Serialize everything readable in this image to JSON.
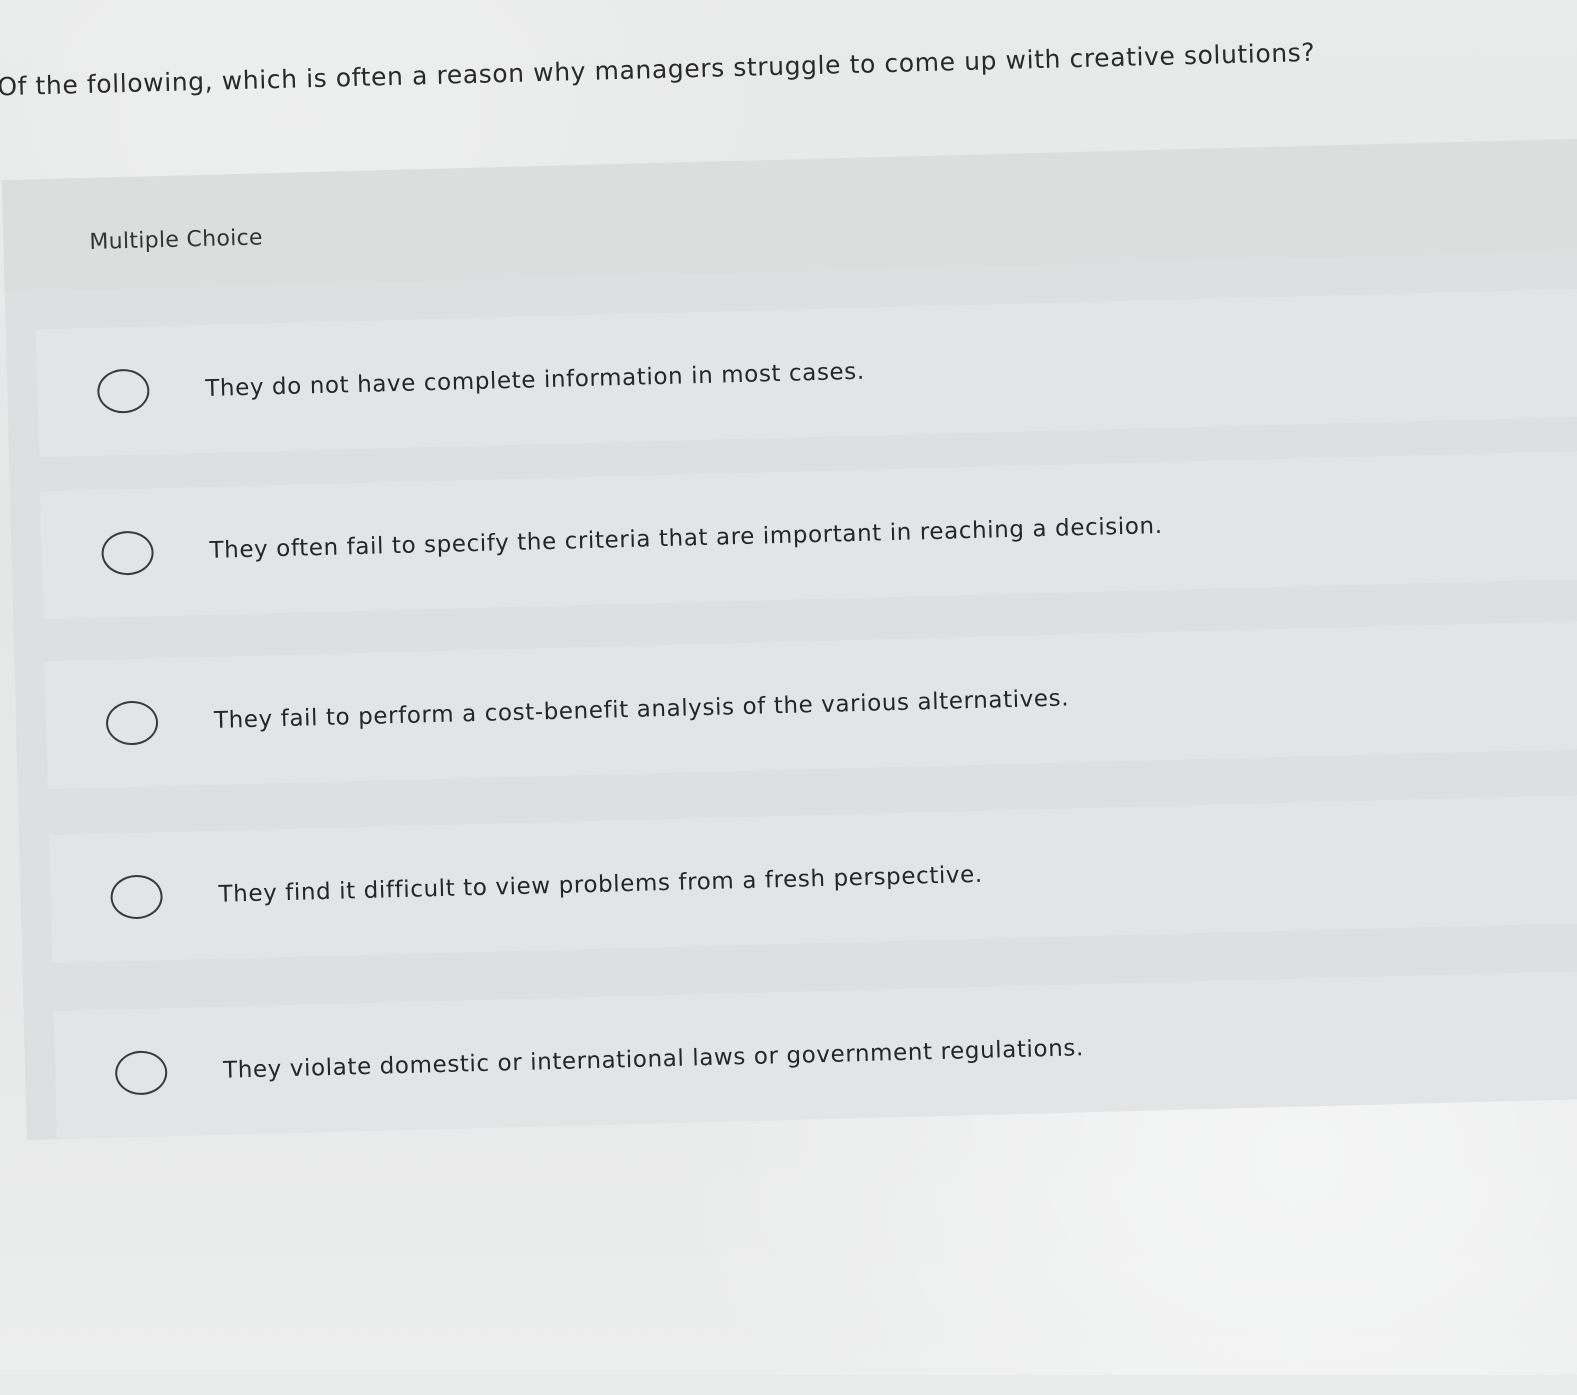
{
  "question": {
    "text": "Of the following, which is often a reason why managers struggle to come up with creative solutions?"
  },
  "section": {
    "type_label": "Multiple Choice"
  },
  "choices": [
    {
      "label": "They do not have complete information in most cases."
    },
    {
      "label": "They often fail to specify the criteria that are important in reaching a decision."
    },
    {
      "label": "They fail to perform a cost-benefit analysis of the various alternatives."
    },
    {
      "label": "They find it difficult to view problems from a fresh perspective."
    },
    {
      "label": "They violate domestic or international laws or government regulations."
    }
  ],
  "selected_index": null
}
